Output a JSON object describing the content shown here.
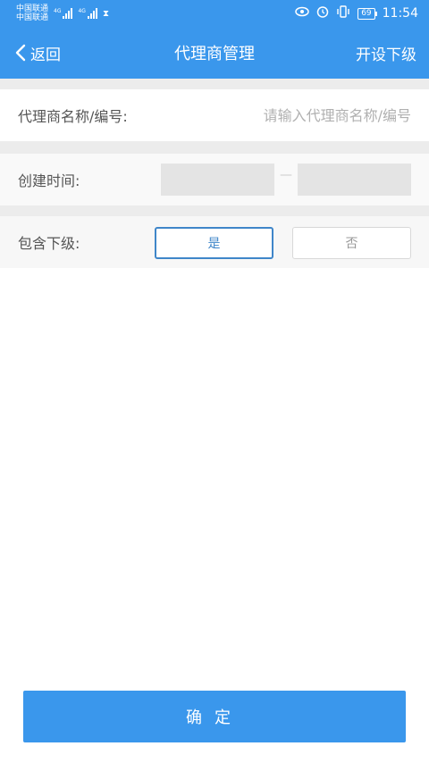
{
  "status_bar": {
    "carrier1": "中国联通",
    "carrier2": "中国联通",
    "network1": "4G",
    "network2": "4G",
    "battery": "69",
    "time": "11:54",
    "icons": [
      "eye-icon",
      "alarm-icon",
      "vibrate-icon",
      "battery-icon",
      "hourglass-icon"
    ]
  },
  "navbar": {
    "back_label": "返回",
    "title": "代理商管理",
    "action_label": "开设下级"
  },
  "form": {
    "name_label": "代理商名称/编号:",
    "name_placeholder": "请输入代理商名称/编号",
    "name_value": "",
    "time_label": "创建时间:",
    "time_separator": "—",
    "time_start": "",
    "time_end": "",
    "sub_label": "包含下级:",
    "opt_yes": "是",
    "opt_no": "否",
    "selected": "是"
  },
  "confirm_label": "确定",
  "colors": {
    "primary": "#3a97ec",
    "selected_border": "#3f86c9",
    "divider": "#ececec"
  }
}
